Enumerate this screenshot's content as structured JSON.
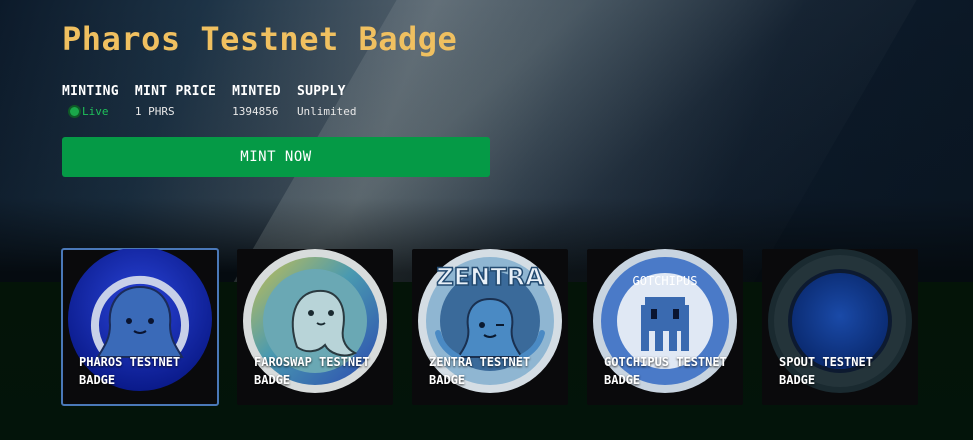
{
  "header": {
    "title": "Pharos Testnet Badge"
  },
  "stats": {
    "minting": {
      "label": "MINTING",
      "value": "Live"
    },
    "mint_price": {
      "label": "MINT PRICE",
      "value": "1 PHRS"
    },
    "minted": {
      "label": "MINTED",
      "value": "1394856"
    },
    "supply": {
      "label": "SUPPLY",
      "value": "Unlimited"
    }
  },
  "mint_button": {
    "label": "MINT NOW"
  },
  "colors": {
    "accent_title": "#f0c060",
    "mint_green": "#059a46",
    "live_green": "#1fc05a",
    "selected_border": "#4a78b8"
  },
  "badges": [
    {
      "label": "PHAROS TESTNET BADGE",
      "selected": true,
      "icon": "octopus-icon"
    },
    {
      "label": "FAROSWAP TESTNET BADGE",
      "selected": false,
      "icon": "dolphin-icon"
    },
    {
      "label": "ZENTRA TESTNET BADGE",
      "selected": false,
      "icon": "octopus-wink-icon",
      "emblem_text": "ZENTRA"
    },
    {
      "label": "GOTCHIPUS TESTNET BADGE",
      "selected": false,
      "icon": "pixel-octopus-icon",
      "emblem_text": "GOTCHIPUS"
    },
    {
      "label": "SPOUT TESTNET BADGE",
      "selected": false,
      "icon": "blank-coin-icon"
    }
  ]
}
